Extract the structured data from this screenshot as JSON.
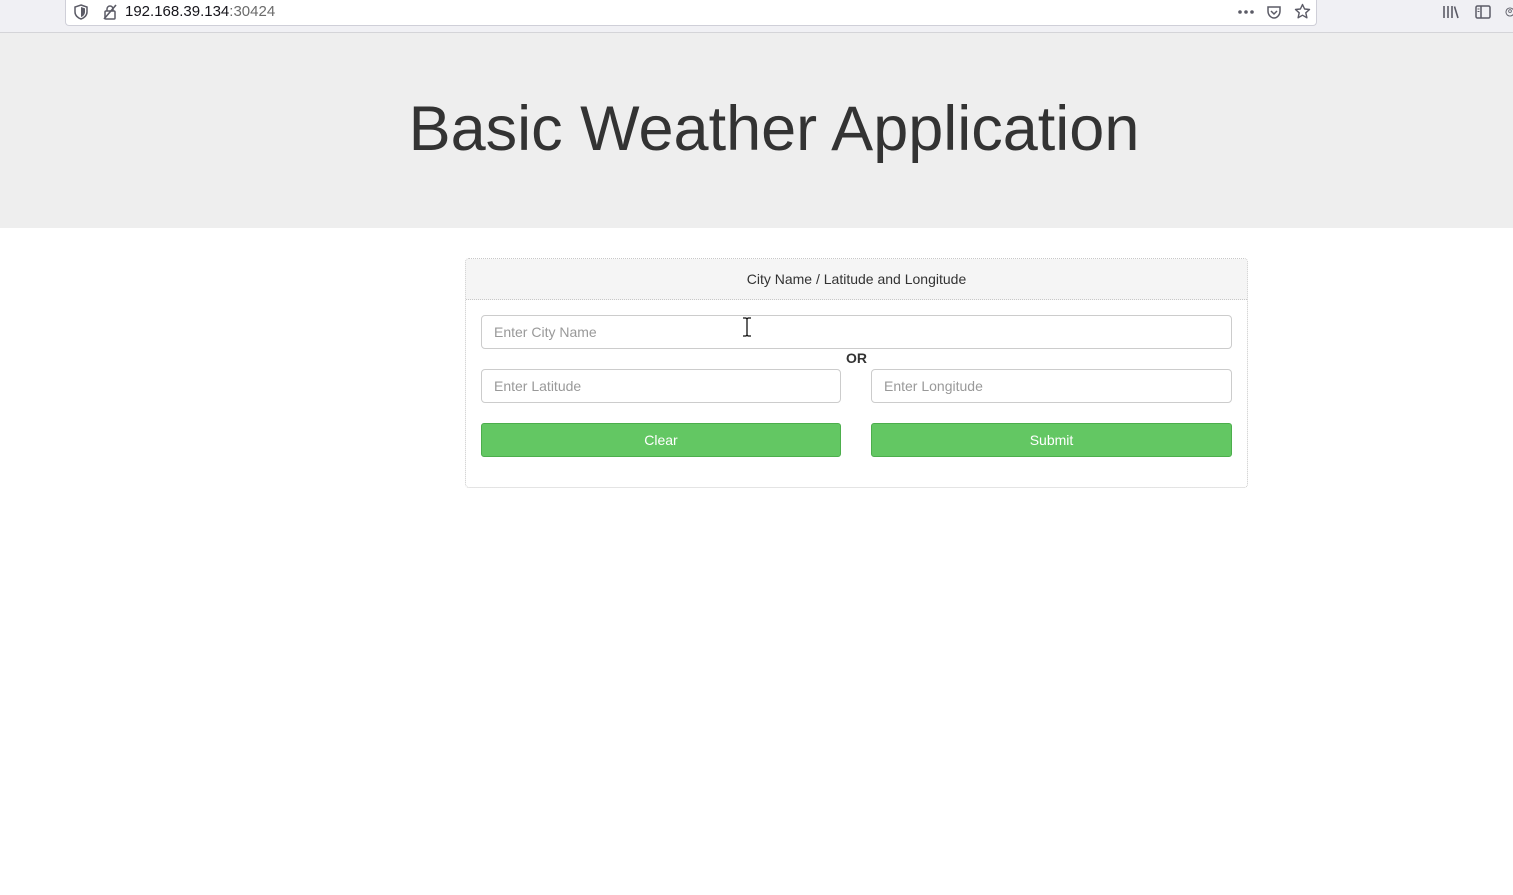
{
  "browser": {
    "url_host": "192.168.39.134",
    "url_port": ":30424",
    "icons": [
      "shield-icon",
      "insecure-connection-icon",
      "more-icon",
      "pocket-icon",
      "star-icon",
      "library-icon",
      "sidebar-icon"
    ]
  },
  "header": {
    "title": "Basic Weather Application"
  },
  "panel": {
    "heading": "City Name / Latitude and Longitude",
    "city_placeholder": "Enter City Name",
    "or_label": "OR",
    "latitude_placeholder": "Enter Latitude",
    "longitude_placeholder": "Enter Longitude",
    "clear_label": "Clear",
    "submit_label": "Submit"
  },
  "colors": {
    "jumbotron_bg": "#eeeeee",
    "button_green": "#63c763",
    "panel_heading_bg": "#f5f5f5"
  }
}
